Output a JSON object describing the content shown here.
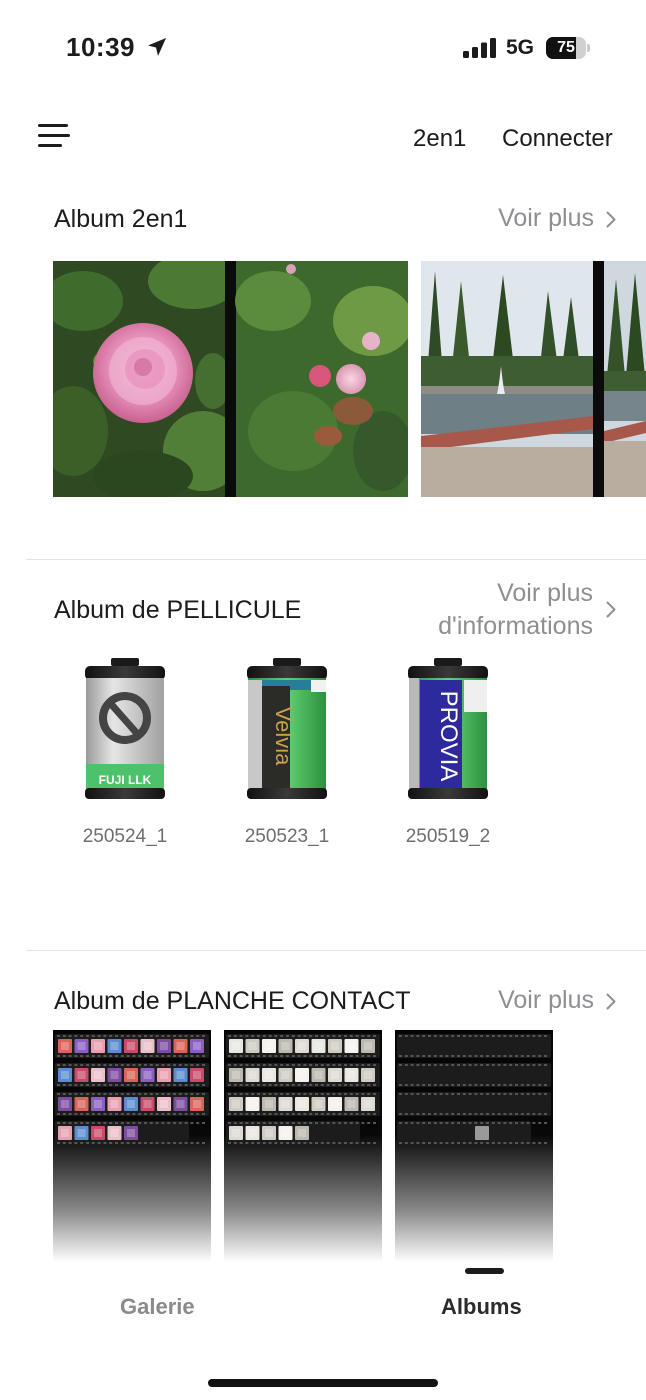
{
  "status_bar": {
    "time": "10:39",
    "network": "5G",
    "battery_percent": "75",
    "battery_level": 0.75
  },
  "nav": {
    "mode_link": "2en1",
    "connect_link": "Connecter"
  },
  "albums": {
    "two_in_one": {
      "title": "Album 2en1",
      "see_more": "Voir plus"
    },
    "film": {
      "title": "Album de PELLICULE",
      "see_more_line1": "Voir plus",
      "see_more_line2": "d'informations",
      "rolls": [
        {
          "label": "250524_1",
          "brand": "FUJI LLK",
          "band_color": "#4cc26a"
        },
        {
          "label": "250523_1",
          "brand": "Velvia",
          "band_color": "#49b95e"
        },
        {
          "label": "250519_2",
          "brand": "PROVIA",
          "band_color": "#2d2a9e"
        }
      ]
    },
    "contact_sheet": {
      "title": "Album de PLANCHE CONTACT",
      "see_more": "Voir plus"
    }
  },
  "tabs": {
    "gallery": "Galerie",
    "albums": "Albums",
    "active": "albums"
  },
  "colors": {
    "accent_text": "#1c1c1e",
    "secondary_text": "#8e8e93",
    "tab_inactive": "#8a8a8e"
  },
  "icons": {
    "menu": "menu-icon",
    "location": "location-arrow-icon",
    "chevron": "chevron-right-icon"
  }
}
